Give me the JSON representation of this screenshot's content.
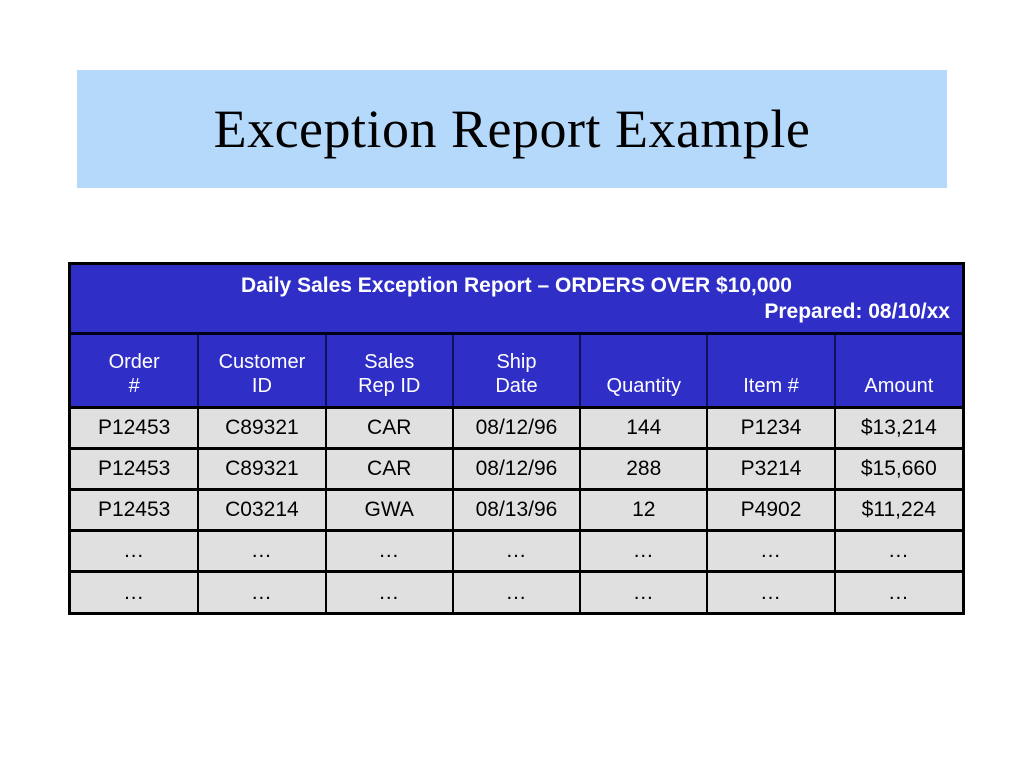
{
  "slide": {
    "title": "Exception Report Example",
    "banner_color": "#b5d9fb",
    "background_color": "#ffffff"
  },
  "report": {
    "header_color": "#2f2fc8",
    "cell_color": "#e0e0e0",
    "title": "Daily Sales Exception Report – ORDERS OVER $10,000",
    "prepared": "Prepared: 08/10/xx",
    "columns": [
      {
        "line1": "Order",
        "line2": "#"
      },
      {
        "line1": "Customer",
        "line2": "ID"
      },
      {
        "line1": "Sales",
        "line2": "Rep ID"
      },
      {
        "line1": "Ship",
        "line2": "Date"
      },
      {
        "line1": "",
        "line2": "Quantity"
      },
      {
        "line1": "",
        "line2": "Item #"
      },
      {
        "line1": "",
        "line2": "Amount"
      }
    ],
    "rows": [
      [
        "P12453",
        "C89321",
        "CAR",
        "08/12/96",
        "144",
        "P1234",
        "$13,214"
      ],
      [
        "P12453",
        "C89321",
        "CAR",
        "08/12/96",
        "288",
        "P3214",
        "$15,660"
      ],
      [
        "P12453",
        "C03214",
        "GWA",
        "08/13/96",
        "12",
        "P4902",
        "$11,224"
      ],
      [
        "…",
        "…",
        "…",
        "…",
        "…",
        "…",
        "…"
      ],
      [
        "…",
        "…",
        "…",
        "…",
        "…",
        "…",
        "…"
      ]
    ]
  }
}
